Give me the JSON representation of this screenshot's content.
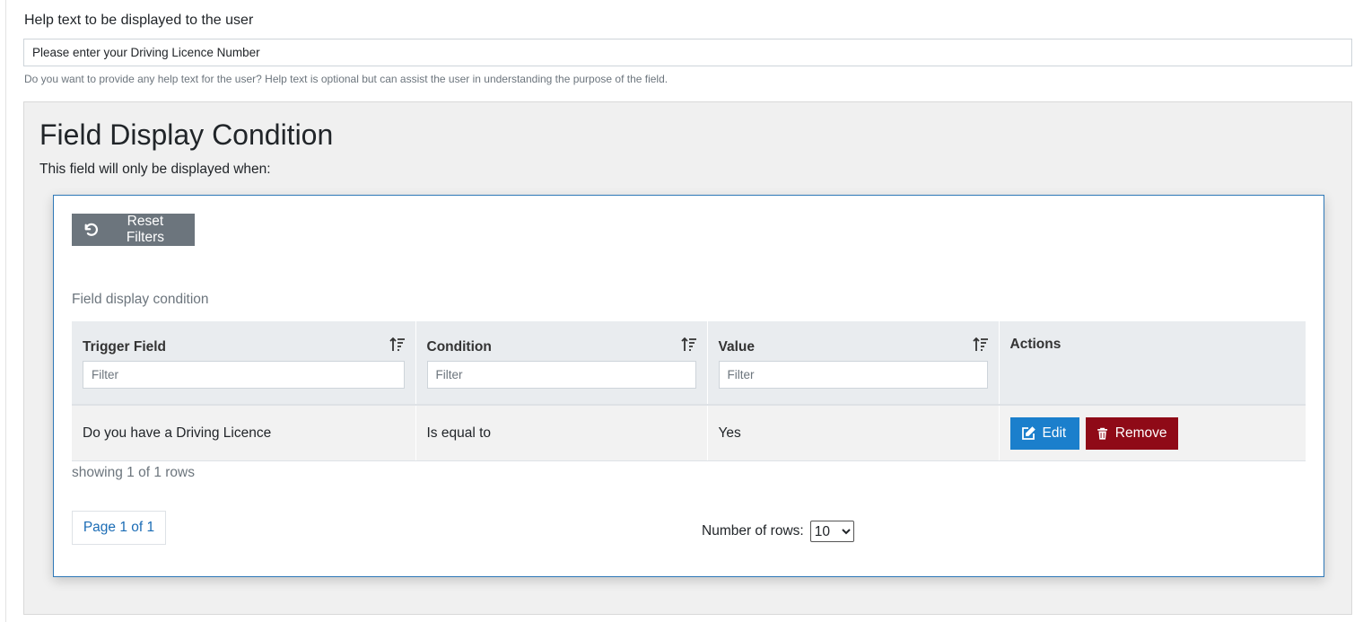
{
  "help_text": {
    "label": "Help text to be displayed to the user",
    "value": "Please enter your Driving Licence Number",
    "hint": "Do you want to provide any help text for the user? Help text is optional but can assist the user in understanding the purpose of the field."
  },
  "section": {
    "title": "Field Display Condition",
    "subtitle": "This field will only be displayed when:"
  },
  "toolbar": {
    "reset_label": "Reset Filters"
  },
  "table": {
    "caption": "Field display condition",
    "columns": [
      {
        "label": "Trigger Field",
        "filter_placeholder": "Filter",
        "sortable": true
      },
      {
        "label": "Condition",
        "filter_placeholder": "Filter",
        "sortable": true
      },
      {
        "label": "Value",
        "filter_placeholder": "Filter",
        "sortable": true
      },
      {
        "label": "Actions"
      }
    ],
    "rows": [
      {
        "trigger_field": "Do you have a Driving Licence",
        "condition": "Is equal to",
        "value": "Yes"
      }
    ],
    "actions": {
      "edit_label": "Edit",
      "remove_label": "Remove"
    },
    "row_count_text": "showing 1 of 1 rows"
  },
  "pagination": {
    "page_label": "Page 1 of 1",
    "rows_label": "Number of rows:",
    "rows_selected": "10"
  },
  "colors": {
    "reset_button": "#6c757d",
    "edit_button": "#1b7fcc",
    "remove_button": "#8f0a17",
    "panel_border": "#2e78b7"
  }
}
